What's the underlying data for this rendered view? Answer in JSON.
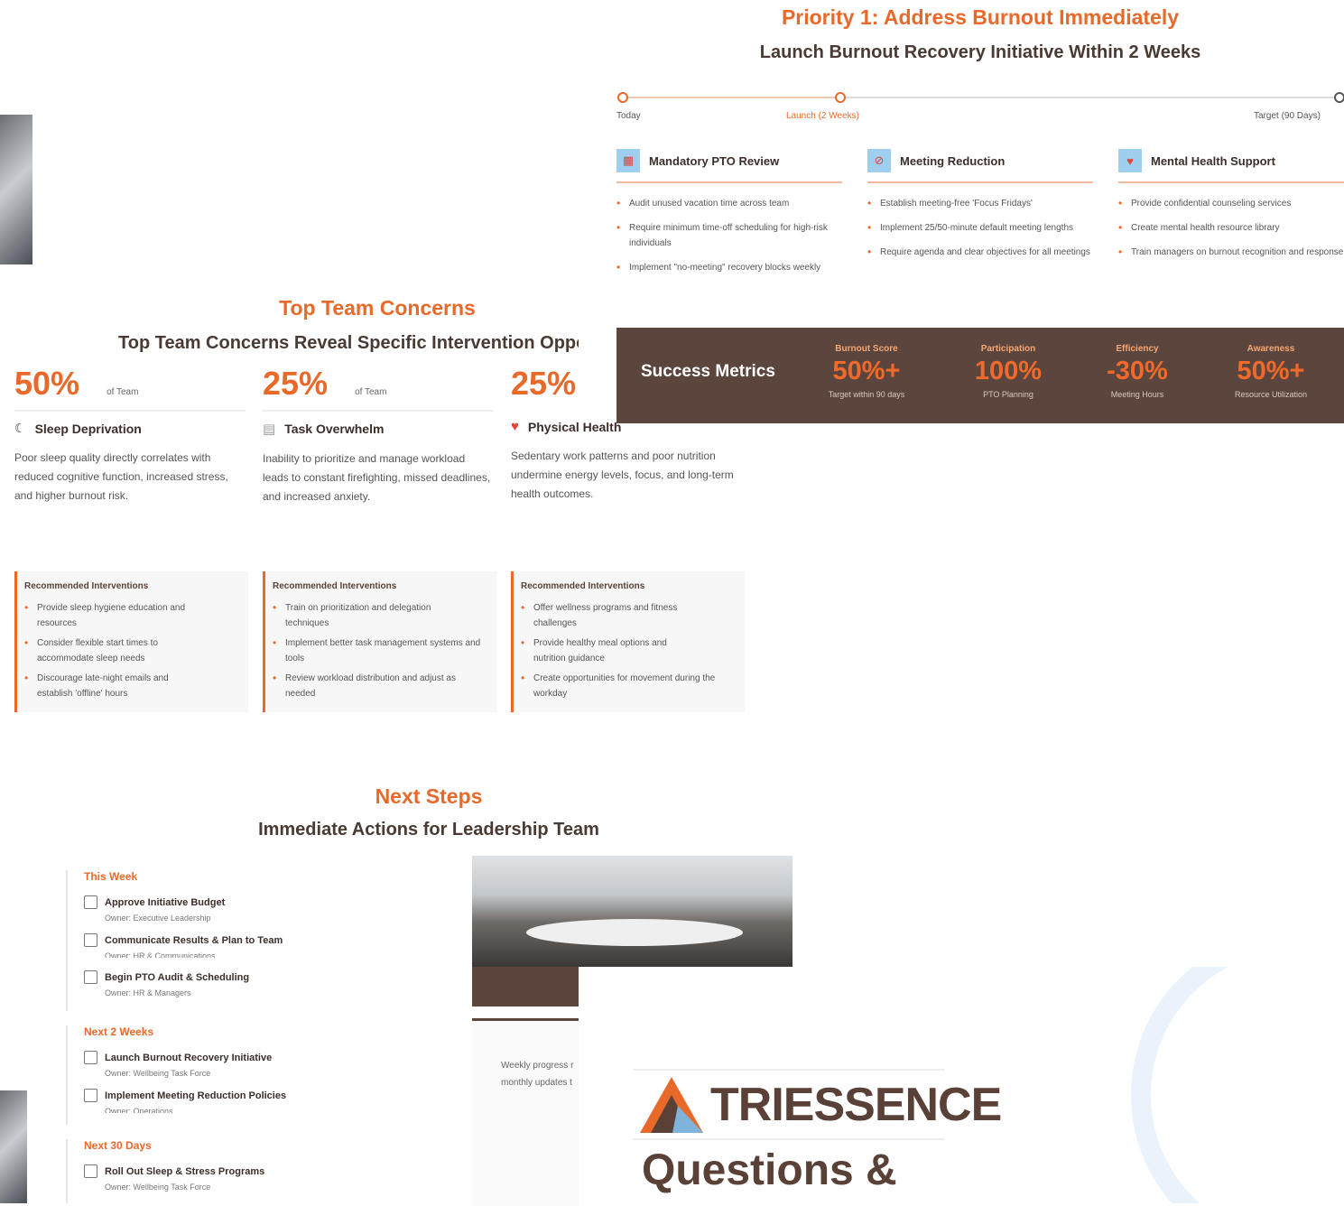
{
  "priority": {
    "title": "Priority 1: Address Burnout Immediately",
    "subtitle": "Launch Burnout Recovery Initiative Within 2 Weeks",
    "timeline": {
      "today": "Today",
      "launch": "Launch (2 Weeks)",
      "target": "Target (90 Days)"
    },
    "columns": [
      {
        "title": "Mandatory PTO Review",
        "icon": "calendar-icon",
        "items": [
          "Audit unused vacation time across team",
          "Require minimum time-off scheduling for high-risk individuals",
          "Implement \"no-meeting\" recovery blocks weekly"
        ]
      },
      {
        "title": "Meeting Reduction",
        "icon": "no-meeting-icon",
        "items": [
          "Establish meeting-free 'Focus Fridays'",
          "Implement 25/50-minute default meeting lengths",
          "Require agenda and clear objectives for all meetings"
        ]
      },
      {
        "title": "Mental Health Support",
        "icon": "heart-icon",
        "items": [
          "Provide confidential counseling services",
          "Create mental health resource library",
          "Train managers on burnout recognition and response"
        ]
      }
    ]
  },
  "metrics": {
    "title": "Success Metrics",
    "items": [
      {
        "label": "Burnout Score",
        "value": "50%+",
        "desc": "Target within 90 days"
      },
      {
        "label": "Participation",
        "value": "100%",
        "desc": "PTO Planning"
      },
      {
        "label": "Efficiency",
        "value": "-30%",
        "desc": "Meeting Hours"
      },
      {
        "label": "Awareness",
        "value": "50%+",
        "desc": "Resource Utilization"
      }
    ]
  },
  "concerns": {
    "title": "Top Team Concerns",
    "subtitle": "Top Team Concerns Reveal Specific Intervention Opport",
    "of_team": "of Team",
    "items": [
      {
        "pct": "50%",
        "icon": "moon-icon",
        "icon_glyph": "☾",
        "title": "Sleep Deprivation",
        "desc": "Poor sleep quality directly correlates with reduced cognitive function, increased stress, and higher burnout risk.",
        "rec_title": "Recommended Interventions",
        "recs": [
          "Provide sleep hygiene education and resources",
          "Consider flexible start times to accommodate sleep needs",
          "Discourage late-night emails and establish 'offline' hours"
        ]
      },
      {
        "pct": "25%",
        "icon": "list-icon",
        "icon_glyph": "▤",
        "title": "Task Overwhelm",
        "desc": "Inability to prioritize and manage workload leads to constant firefighting, missed deadlines, and increased anxiety.",
        "rec_title": "Recommended Interventions",
        "recs": [
          "Train on prioritization and delegation techniques",
          "Implement better task management systems and tools",
          "Review workload distribution and adjust as needed"
        ]
      },
      {
        "pct": "25%",
        "icon": "heart-icon",
        "icon_glyph": "♥",
        "title": "Physical Health",
        "desc": "Sedentary work patterns and poor nutrition undermine energy levels, focus, and long-term health outcomes.",
        "rec_title": "Recommended Interventions",
        "recs": [
          "Offer wellness programs and fitness challenges",
          "Provide healthy meal options and nutrition guidance",
          "Create opportunities for movement during the workday"
        ]
      }
    ]
  },
  "next_steps": {
    "title": "Next Steps",
    "subtitle": "Immediate Actions for Leadership Team",
    "phases": [
      {
        "label": "This Week",
        "tasks": [
          {
            "title": "Approve Initiative Budget",
            "owner": "Owner: Executive Leadership"
          },
          {
            "title": "Communicate Results & Plan to Team",
            "owner": "Owner: HR & Communications"
          },
          {
            "title": "Begin PTO Audit & Scheduling",
            "owner": "Owner: HR & Managers"
          }
        ]
      },
      {
        "label": "Next 2 Weeks",
        "tasks": [
          {
            "title": "Launch Burnout Recovery Initiative",
            "owner": "Owner: Wellbeing Task Force"
          },
          {
            "title": "Implement Meeting Reduction Policies",
            "owner": "Owner: Operations"
          }
        ]
      },
      {
        "label": "Next 30 Days",
        "tasks": [
          {
            "title": "Roll Out Sleep & Stress Programs",
            "owner": "Owner: Wellbeing Task Force"
          }
        ]
      }
    ],
    "progress_note_1": "Weekly progress r",
    "progress_note_2": "monthly updates t"
  },
  "closing": {
    "logo": "TRIESSENCE",
    "heading": "Questions &"
  },
  "colors": {
    "accent": "#e8692a",
    "brown": "#5c453c"
  }
}
